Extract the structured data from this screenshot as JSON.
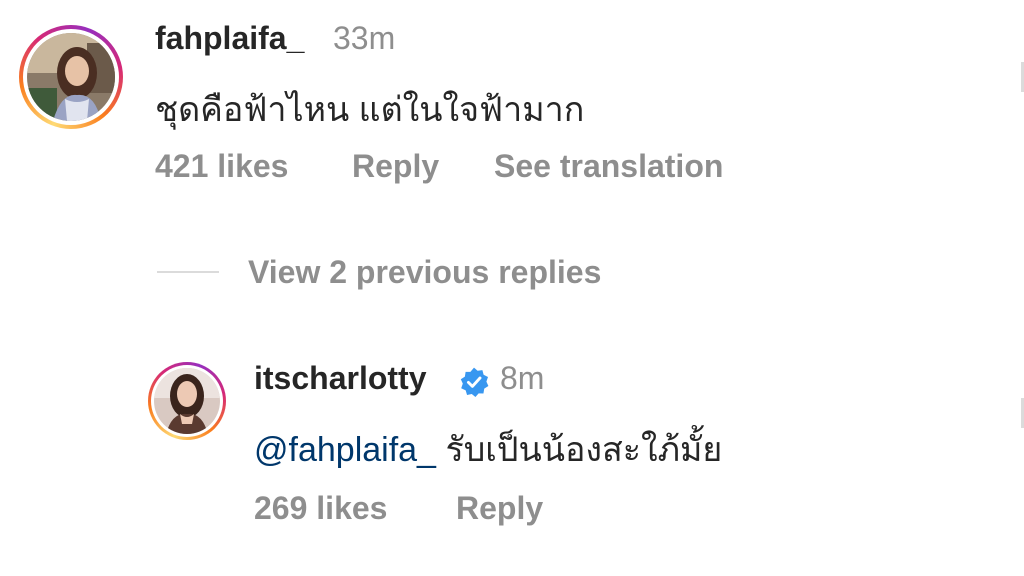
{
  "comment": {
    "username": "fahplaifa_",
    "time": "33m",
    "text": "ชุดคือฟ้าไหน แต่ในใจฟ้ามาก",
    "likes": "421 likes",
    "reply_label": "Reply",
    "translate_label": "See translation"
  },
  "replies_toggle": {
    "label": "View 2 previous replies"
  },
  "reply": {
    "username": "itscharlotty",
    "verified": true,
    "time": "8m",
    "mention": "@fahplaifa_",
    "text": "รับเป็นน้องสะใภ้มั้ย",
    "likes": "269 likes",
    "reply_label": "Reply"
  },
  "colors": {
    "text_primary": "#262626",
    "text_secondary": "#8e8e8e",
    "mention": "#00376b",
    "verified_badge": "#3897f0"
  }
}
